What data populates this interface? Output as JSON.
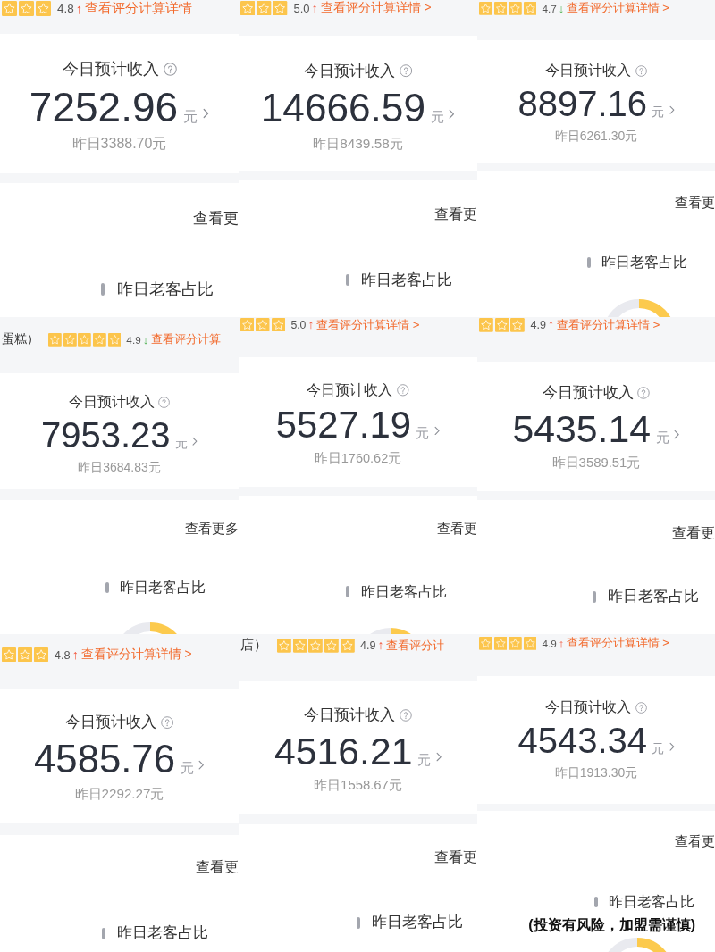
{
  "tiles": [
    {
      "rating": {
        "stars": 3,
        "score": "4.8",
        "trend": {
          "kind": "up",
          "arrow": "↑"
        },
        "link": "查看评分计算详情"
      },
      "income": {
        "title": "今日预计收入",
        "amount": "7252.96",
        "unit": "元",
        "yesterday": "昨日3388.70元"
      },
      "more_link": "查看更",
      "section_title": "昨日老客占比"
    },
    {
      "rating": {
        "stars": 3,
        "score": "5.0",
        "trend": {
          "kind": "up",
          "arrow": "↑"
        },
        "link": "查看评分计算详情 >"
      },
      "income": {
        "title": "今日预计收入",
        "amount": "14666.59",
        "unit": "元",
        "yesterday": "昨日8439.58元"
      },
      "more_link": "查看更",
      "section_title": "昨日老客占比"
    },
    {
      "rating": {
        "stars": 4,
        "score": "4.7",
        "trend": {
          "kind": "down",
          "arrow": "↓"
        },
        "link": "查看评分计算详情 >"
      },
      "income": {
        "title": "今日预计收入",
        "amount": "8897.16",
        "unit": "元",
        "yesterday": "昨日6261.30元"
      },
      "more_link": "查看更",
      "section_title": "昨日老客占比"
    },
    {
      "rating": {
        "store_name": "蛋糕）",
        "stars": 5,
        "score": "4.9",
        "trend": {
          "kind": "down",
          "arrow": "↓"
        },
        "link": "查看评分计算"
      },
      "income": {
        "title": "今日预计收入",
        "amount": "7953.23",
        "unit": "元",
        "yesterday": "昨日3684.83元"
      },
      "more_link": "查看更多",
      "section_title": "昨日老客占比"
    },
    {
      "rating": {
        "stars": 3,
        "score": "5.0",
        "trend": {
          "kind": "up",
          "arrow": "↑"
        },
        "link": "查看评分计算详情 >"
      },
      "income": {
        "title": "今日预计收入",
        "amount": "5527.19",
        "unit": "元",
        "yesterday": "昨日1760.62元"
      },
      "more_link": "查看更",
      "section_title": "昨日老客占比"
    },
    {
      "rating": {
        "stars": 3,
        "score": "4.9",
        "trend": {
          "kind": "up",
          "arrow": "↑"
        },
        "link": "查看评分计算详情 >"
      },
      "income": {
        "title": "今日预计收入",
        "amount": "5435.14",
        "unit": "元",
        "yesterday": "昨日3589.51元"
      },
      "more_link": "查看更",
      "section_title": "昨日老客占比"
    },
    {
      "rating": {
        "stars": 3,
        "score": "4.8",
        "trend": {
          "kind": "up",
          "arrow": "↑"
        },
        "link": "查看评分计算详情 >"
      },
      "income": {
        "title": "今日预计收入",
        "amount": "4585.76",
        "unit": "元",
        "yesterday": "昨日2292.27元"
      },
      "more_link": "查看更",
      "section_title": "昨日老客占比"
    },
    {
      "rating": {
        "store_name": "店）",
        "stars": 5,
        "score": "4.9",
        "trend": {
          "kind": "up",
          "arrow": "↑"
        },
        "link": "查看评分计"
      },
      "income": {
        "title": "今日预计收入",
        "amount": "4516.21",
        "unit": "元",
        "yesterday": "昨日1558.67元"
      },
      "more_link": "查看更",
      "section_title": "昨日老客占比"
    },
    {
      "rating": {
        "stars": 4,
        "score": "4.9",
        "trend": {
          "kind": "up",
          "arrow": "↑"
        },
        "link": "查看评分计算详情 >"
      },
      "income": {
        "title": "今日预计收入",
        "amount": "4543.34",
        "unit": "元",
        "yesterday": "昨日1913.30元"
      },
      "more_link": "查看更",
      "section_title": "昨日老客占比"
    }
  ],
  "caption": "(投资有风险，加盟需谨慎)"
}
